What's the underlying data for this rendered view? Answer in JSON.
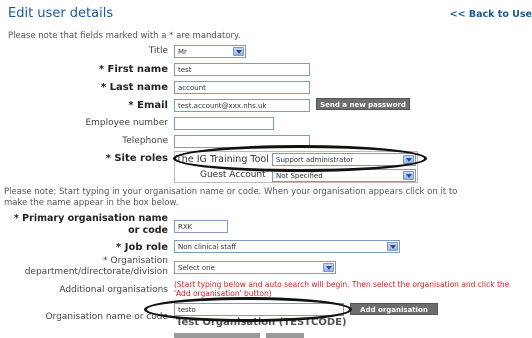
{
  "header": {
    "title": "Edit user details",
    "back_link": "<< Back to Use"
  },
  "mandatory_note": "Please note that fields marked with a * are mandatory.",
  "fields": {
    "title": {
      "label": "Title",
      "value": "Mr"
    },
    "first_name": {
      "label": "* First name",
      "value": "test"
    },
    "last_name": {
      "label": "* Last name",
      "value": "account"
    },
    "email": {
      "label": "* Email",
      "value": "test.account@xxx.nhs.uk"
    },
    "employee_number": {
      "label": "Employee number",
      "value": ""
    },
    "telephone": {
      "label": "Telephone",
      "value": ""
    }
  },
  "send_password_button": "Send a new password",
  "site_roles": {
    "label": "* Site roles",
    "rows": [
      {
        "site": "The IG Training Tool",
        "role": "Support administrator"
      },
      {
        "site": "Guest Account",
        "role": "Not Specified"
      }
    ]
  },
  "org_note_line1": "Please note: Start typing in your organisation name or code. When your organisation appears click on it to",
  "org_note_line2": "make the name appear in the box below.",
  "primary_org": {
    "label_line1": "* Primary organisation name",
    "label_line2": "or code",
    "value": "RXK"
  },
  "job_role": {
    "label": "* Job role",
    "value": "Non clinical staff"
  },
  "org_dept": {
    "label_line1": "* Organisation",
    "label_line2": "department/directorate/division",
    "value": "Select one"
  },
  "additional_orgs": {
    "label": "Additional organisations",
    "warning_line1": "(Start typing below and auto search will begin. Then select the organisation and click the",
    "warning_line2": "'Add organisation' button)"
  },
  "org_search": {
    "label": "Organisation name or code",
    "value": "testo"
  },
  "add_org_button": "Add organisation",
  "suggestion": "Test Organisation (TESTCODE)",
  "colors": {
    "title": "#1a5a9a",
    "warning": "#d42020",
    "button": "#6d6d6d",
    "highlight_ellipse": "#111111"
  }
}
